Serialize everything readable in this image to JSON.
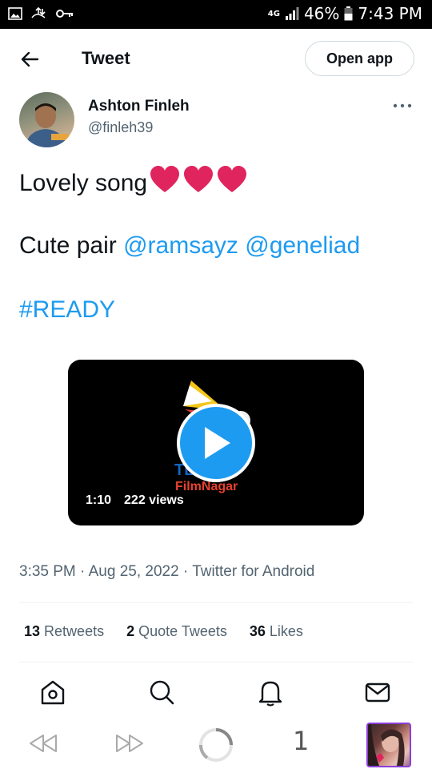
{
  "status_bar": {
    "network": "4G",
    "battery": "46%",
    "time": "7:43 PM"
  },
  "header": {
    "title": "Tweet",
    "open_app_label": "Open app"
  },
  "author": {
    "name": "Ashton Finleh",
    "handle": "@finleh39"
  },
  "tweet": {
    "line1_text": "Lovely song",
    "line2_prefix": "Cute pair ",
    "mention1": "@ramsayz",
    "mention2": "@geneliad",
    "hashtag": "#READY"
  },
  "video": {
    "logo_top_text": "TELUGU",
    "logo_text": "FilmNagar",
    "duration": "1:10",
    "views": "222 views"
  },
  "meta": {
    "time": "3:35 PM",
    "date": "Aug 25, 2022",
    "source": "Twitter for Android",
    "separator": " · "
  },
  "stats": {
    "retweets_count": "13",
    "retweets_label": "Retweets",
    "quote_count": "2",
    "quote_label": "Quote Tweets",
    "likes_count": "36",
    "likes_label": "Likes"
  },
  "bottom_nav": {
    "items": [
      "home-icon",
      "search-icon",
      "notifications-icon",
      "messages-icon"
    ]
  },
  "browser_bar": {
    "tab_count": "1"
  },
  "colors": {
    "accent": "#1d9bf0",
    "text": "#0f1419",
    "secondary": "#536471",
    "heart": "#e0245e"
  }
}
